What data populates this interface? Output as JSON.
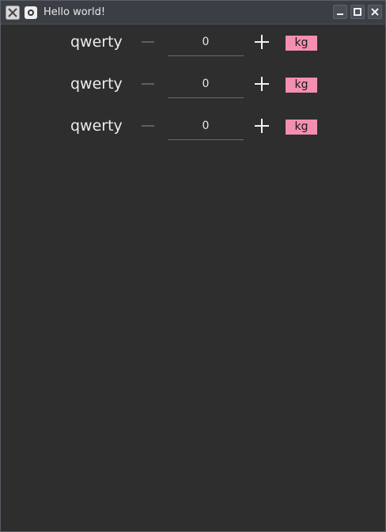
{
  "window": {
    "title": "Hello world!"
  },
  "rows": [
    {
      "label": "qwerty",
      "value": "0",
      "unit": "kg"
    },
    {
      "label": "qwerty",
      "value": "0",
      "unit": "kg"
    },
    {
      "label": "qwerty",
      "value": "0",
      "unit": "kg"
    }
  ],
  "icons": {
    "app": "x-app-icon",
    "menu": "window-menu-icon",
    "minimize": "minimize-icon",
    "maximize": "maximize-icon",
    "close": "close-icon",
    "decrement": "minus-icon",
    "increment": "plus-icon"
  },
  "colors": {
    "background": "#2e2e2e",
    "titlebar": "#3b3f45",
    "unit_badge": "#f48fb1",
    "text": "#ececec"
  }
}
